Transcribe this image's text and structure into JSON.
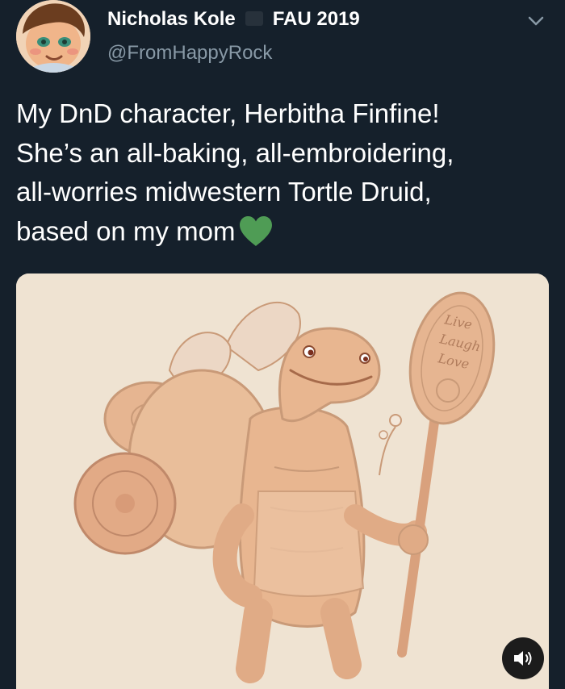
{
  "tweet": {
    "author": {
      "display_name": "Nicholas Kole",
      "flair": "FAU 2019",
      "handle": "@FromHappyRock",
      "avatar_icon": "avatar-portrait"
    },
    "menu_icon": "chevron-down-icon",
    "text_lines": [
      "My DnD character, Herbitha Finfine!",
      "She’s an all-baking, all-embroidering,",
      "all-worries midwestern Tortle Druid,",
      "based on my mom"
    ],
    "emoji": "green-heart-icon",
    "media": {
      "type": "video",
      "subject": "sketch of a tortle druid holding a wooden spoon staff",
      "spoon_inscription": [
        "Live",
        "Laugh",
        "Love"
      ],
      "sound_icon": "speaker-icon"
    }
  },
  "colors": {
    "background": "#15202b",
    "text": "#ffffff",
    "muted": "#8899a6",
    "heart": "#4f9c55",
    "media_background": "#efe3d2",
    "sketch_fill": "#e6b591",
    "sketch_line": "#c99a78"
  }
}
